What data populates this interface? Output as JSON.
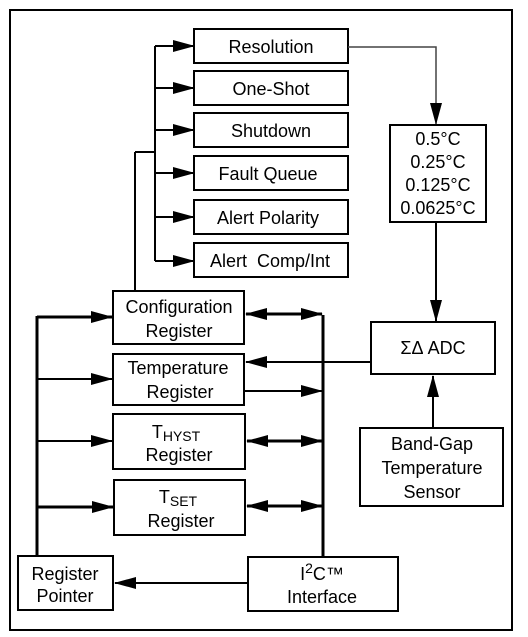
{
  "config_options": [
    "Resolution",
    "One-Shot",
    "Shutdown",
    "Fault Queue",
    "Alert Polarity",
    "Alert  Comp/Int"
  ],
  "resolution_values": [
    "0.5°C",
    "0.25°C",
    "0.125°C",
    "0.0625°C"
  ],
  "configuration_register": [
    "Configuration",
    "Register"
  ],
  "temperature_register": [
    "Temperature",
    "Register"
  ],
  "thyst_register": {
    "main": "T",
    "sub": "HYST",
    "line2": "Register"
  },
  "tset_register": {
    "main": "T",
    "sub": "SET",
    "line2": "Register"
  },
  "register_pointer": [
    "Register",
    "Pointer"
  ],
  "i2c_interface": {
    "main": "I",
    "sup": "2",
    "rest": "C™",
    "line2": "Interface"
  },
  "adc": "ΣΔ ADC",
  "sensor": [
    "Band-Gap",
    "Temperature",
    "Sensor"
  ]
}
